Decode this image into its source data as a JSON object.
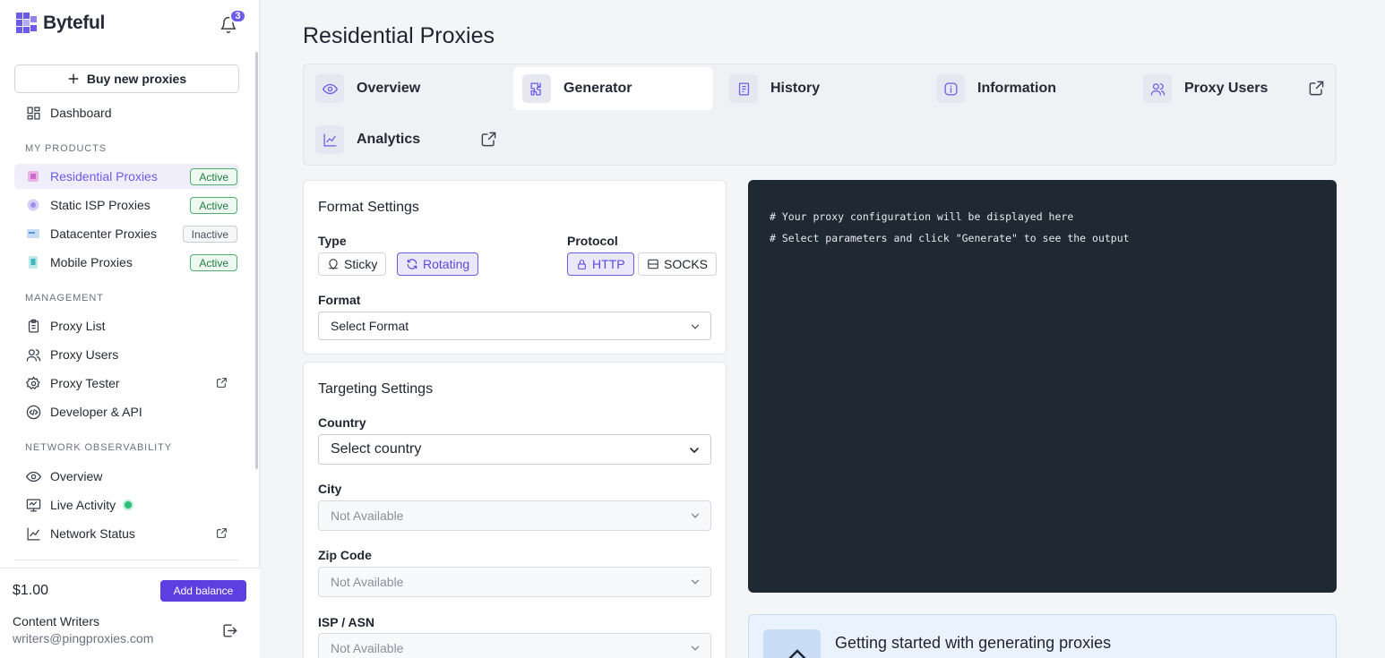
{
  "brand": {
    "name": "Byteful",
    "notification_count": "3"
  },
  "sidebar": {
    "buy_button": "Buy new proxies",
    "dashboard": "Dashboard",
    "sections": {
      "products": "MY PRODUCTS",
      "management": "MANAGEMENT",
      "observability": "NETWORK OBSERVABILITY"
    },
    "products": [
      {
        "label": "Residential Proxies",
        "status": "Active"
      },
      {
        "label": "Static ISP Proxies",
        "status": "Active"
      },
      {
        "label": "Datacenter Proxies",
        "status": "Inactive"
      },
      {
        "label": "Mobile Proxies",
        "status": "Active"
      }
    ],
    "management": [
      {
        "label": "Proxy List"
      },
      {
        "label": "Proxy Users"
      },
      {
        "label": "Proxy Tester"
      },
      {
        "label": "Developer & API"
      }
    ],
    "observability": [
      {
        "label": "Overview"
      },
      {
        "label": "Live Activity"
      },
      {
        "label": "Network Status"
      }
    ],
    "balance": "$1.00",
    "add_balance": "Add balance",
    "user_name": "Content Writers",
    "user_email": "writers@pingproxies.com"
  },
  "page": {
    "title": "Residential Proxies"
  },
  "tabs": [
    {
      "label": "Overview",
      "icon": "eye-icon"
    },
    {
      "label": "Generator",
      "icon": "puzzle-icon",
      "active": true
    },
    {
      "label": "History",
      "icon": "receipt-icon"
    },
    {
      "label": "Information",
      "icon": "info-icon"
    },
    {
      "label": "Proxy Users",
      "icon": "users-icon"
    },
    {
      "label": "Analytics",
      "icon": "chart-icon"
    }
  ],
  "format_settings": {
    "title": "Format Settings",
    "type_label": "Type",
    "type_options": [
      "Sticky",
      "Rotating"
    ],
    "type_selected": "Rotating",
    "protocol_label": "Protocol",
    "protocol_options": [
      "HTTP",
      "SOCKS"
    ],
    "protocol_selected": "HTTP",
    "format_label": "Format",
    "format_value": "Select Format"
  },
  "targeting_settings": {
    "title": "Targeting Settings",
    "country_label": "Country",
    "country_value": "Select country",
    "city_label": "City",
    "city_value": "Not Available",
    "zip_label": "Zip Code",
    "zip_value": "Not Available",
    "isp_label": "ISP / ASN",
    "isp_value": "Not Available"
  },
  "output": {
    "line1": "# Your proxy configuration will be displayed here",
    "line2": "# Select parameters and click \"Generate\" to see the output"
  },
  "getting_started": {
    "title": "Getting started with generating proxies"
  },
  "colors": {
    "accent": "#6b5ce7",
    "active_badge": "#4fb06d",
    "code_bg": "#1f2933"
  }
}
